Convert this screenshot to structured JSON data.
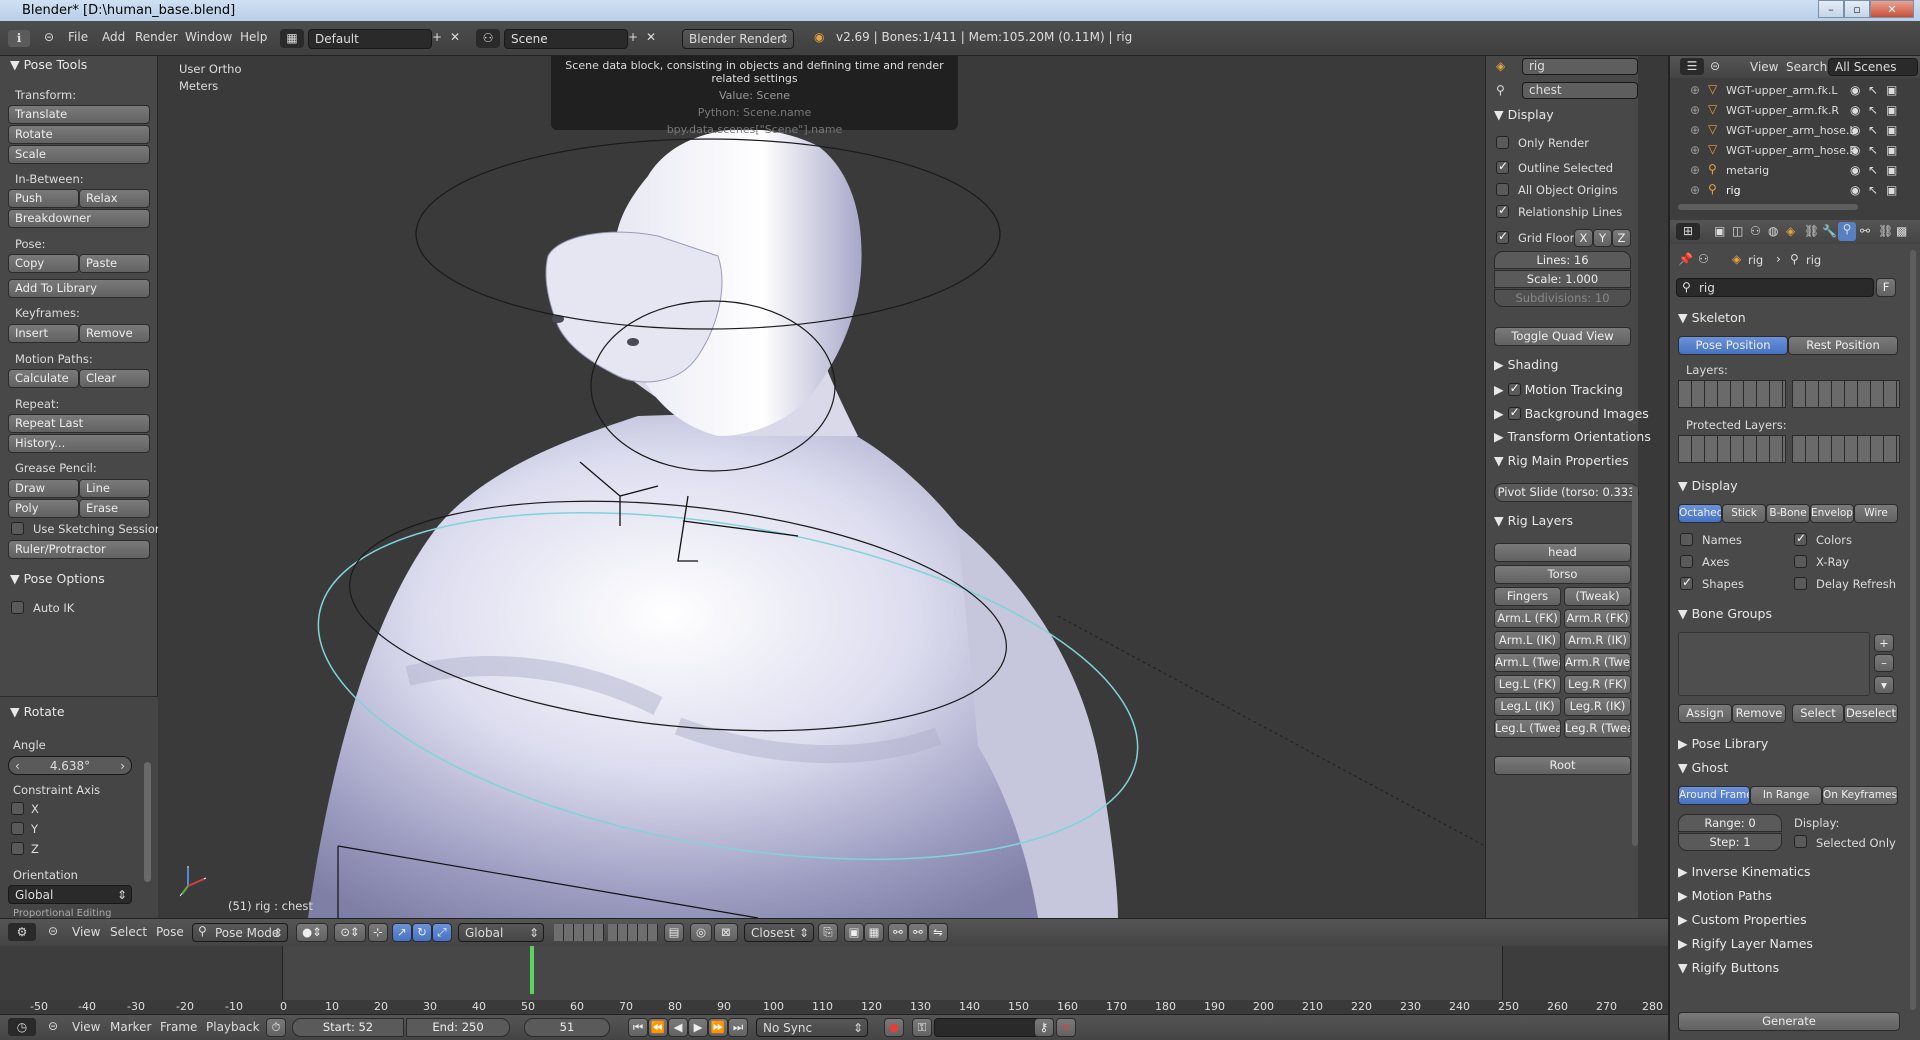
{
  "window": {
    "title": "Blender* [D:\\human_base.blend]"
  },
  "info_header": {
    "menus": [
      "File",
      "Add",
      "Render",
      "Window",
      "Help"
    ],
    "layout": "Default",
    "scene": "Scene",
    "engine": "Blender Render",
    "stats": "v2.69 | Bones:1/411 | Mem:105.20M (0.11M) | rig"
  },
  "tooltip": {
    "description": "Scene data block, consisting in objects and defining time and render related settings",
    "value": "Value: Scene",
    "python": "Python: Scene.name",
    "path": "bpy.data.scenes[\"Scene\"].name"
  },
  "tool_shelf": {
    "title": "Pose Tools",
    "transform_label": "Transform:",
    "translate": "Translate",
    "rotate": "Rotate",
    "scale": "Scale",
    "in_between_label": "In-Between:",
    "push": "Push",
    "relax": "Relax",
    "breakdowner": "Breakdowner",
    "pose_label": "Pose:",
    "copy": "Copy",
    "paste": "Paste",
    "add_to_library": "Add To Library",
    "keyframes_label": "Keyframes:",
    "insert": "Insert",
    "remove": "Remove",
    "motion_paths_label": "Motion Paths:",
    "calculate": "Calculate",
    "clear": "Clear",
    "repeat_label": "Repeat:",
    "repeat_last": "Repeat Last",
    "history": "History...",
    "grease_pencil_label": "Grease Pencil:",
    "draw": "Draw",
    "line": "Line",
    "poly": "Poly",
    "erase": "Erase",
    "use_sketching": "Use Sketching Sessions",
    "ruler": "Ruler/Protractor",
    "pose_options_title": "Pose Options",
    "auto_ik": "Auto IK",
    "rotate_title": "Rotate",
    "angle_label": "Angle",
    "angle_value": "4.638°",
    "constraint_axis_label": "Constraint Axis",
    "axis_x": "X",
    "axis_y": "Y",
    "axis_z": "Z",
    "orientation_label": "Orientation",
    "orientation_value": "Global",
    "proportional_label": "Proportional Editing"
  },
  "viewport": {
    "view_name": "User Ortho",
    "units": "Meters",
    "object_info": "(51) rig : chest"
  },
  "n_panel": {
    "object": "rig",
    "bone": "chest",
    "display_title": "Display",
    "only_render": "Only Render",
    "outline_selected": "Outline Selected",
    "all_object_origins": "All Object Origins",
    "relationship_lines": "Relationship Lines",
    "grid_floor": "Grid Floor",
    "x": "X",
    "y": "Y",
    "z": "Z",
    "lines": "Lines: 16",
    "scale": "Scale: 1.000",
    "subdivisions": "Subdivisions: 10",
    "toggle_quad": "Toggle Quad View",
    "shading": "Shading",
    "motion_tracking": "Motion Tracking",
    "background_images": "Background Images",
    "transform_orientations": "Transform Orientations",
    "rig_main_props": "Rig Main Properties",
    "pivot_slide": "Pivot Slide (torso: 0.333",
    "rig_layers": "Rig Layers",
    "layers": [
      [
        "head"
      ],
      [
        "Torso"
      ],
      [
        "Fingers",
        "(Tweak)"
      ],
      [
        "Arm.L (FK)",
        "Arm.R (FK)"
      ],
      [
        "Arm.L (IK)",
        "Arm.R (IK)"
      ],
      [
        "Arm.L (Twea",
        "Arm.R (Twea"
      ],
      [
        "Leg.L (FK)",
        "Leg.R (FK)"
      ],
      [
        "Leg.L (IK)",
        "Leg.R (IK)"
      ],
      [
        "Leg.L (Tweak",
        "Leg.R (Tweak"
      ]
    ],
    "root": "Root"
  },
  "outliner": {
    "view": "View",
    "search": "Search",
    "filter": "All Scenes",
    "items": [
      "WGT-upper_arm.fk.L",
      "WGT-upper_arm.fk.R",
      "WGT-upper_arm_hose.L",
      "WGT-upper_arm_hose.R",
      "metarig",
      "rig"
    ]
  },
  "properties": {
    "breadcrumb_object": "rig",
    "breadcrumb_data": "rig",
    "datablock": "rig",
    "fake_user": "F",
    "skeleton_title": "Skeleton",
    "pose_position": "Pose Position",
    "rest_position": "Rest Position",
    "layers_label": "Layers:",
    "protected_layers_label": "Protected Layers:",
    "display_title": "Display",
    "display_types": [
      "Octahed",
      "Stick",
      "B-Bone",
      "Envelop",
      "Wire"
    ],
    "names": "Names",
    "colors": "Colors",
    "axes": "Axes",
    "xray": "X-Ray",
    "shapes": "Shapes",
    "delay_refresh": "Delay Refresh",
    "bone_groups_title": "Bone Groups",
    "assign": "Assign",
    "remove": "Remove",
    "select": "Select",
    "deselect": "Deselect",
    "pose_library": "Pose Library",
    "ghost_title": "Ghost",
    "ghost_types": [
      "Around Frame",
      "In Range",
      "On Keyframes"
    ],
    "range": "Range: 0",
    "step": "Step: 1",
    "display_label": "Display:",
    "selected_only": "Selected Only",
    "inverse_kinematics": "Inverse Kinematics",
    "motion_paths": "Motion Paths",
    "custom_properties": "Custom Properties",
    "rigify_layer_names": "Rigify Layer Names",
    "rigify_buttons": "Rigify Buttons",
    "generate": "Generate"
  },
  "viewport_header": {
    "view": "View",
    "select": "Select",
    "pose": "Pose",
    "mode": "Pose Mode",
    "orientation": "Global",
    "snap": "Closest"
  },
  "timeline": {
    "ticks": [
      "-50",
      "-40",
      "-30",
      "-20",
      "-10",
      "0",
      "10",
      "20",
      "30",
      "40",
      "50",
      "60",
      "70",
      "80",
      "90",
      "100",
      "110",
      "120",
      "130",
      "140",
      "150",
      "160",
      "170",
      "180",
      "190",
      "200",
      "210",
      "220",
      "230",
      "240",
      "250",
      "260",
      "270",
      "280"
    ],
    "current_frame": 51
  },
  "timeline_header": {
    "view": "View",
    "marker": "Marker",
    "frame": "Frame",
    "playback": "Playback",
    "start": "Start: 52",
    "end": "End: 250",
    "current": "51",
    "sync": "No Sync"
  }
}
